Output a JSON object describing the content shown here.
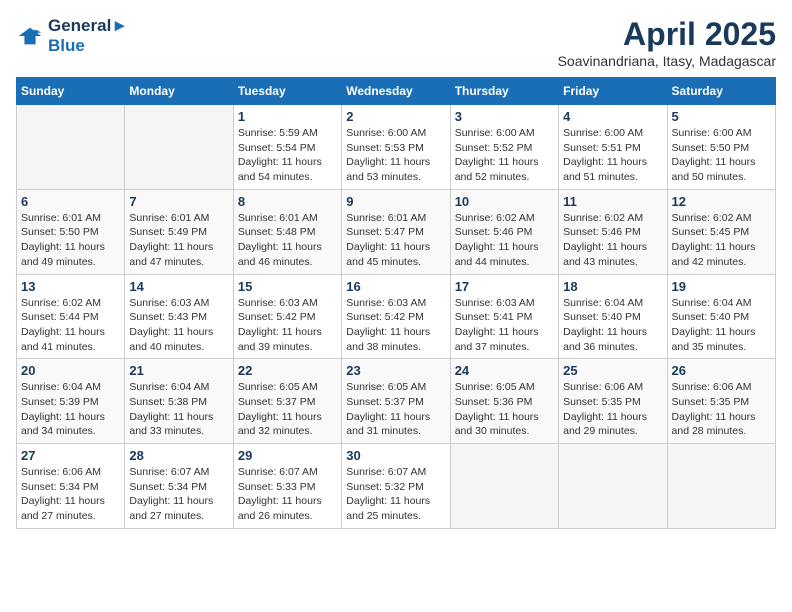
{
  "header": {
    "logo_line1": "General",
    "logo_line2": "Blue",
    "month_title": "April 2025",
    "subtitle": "Soavinandriana, Itasy, Madagascar"
  },
  "days_of_week": [
    "Sunday",
    "Monday",
    "Tuesday",
    "Wednesday",
    "Thursday",
    "Friday",
    "Saturday"
  ],
  "weeks": [
    [
      {
        "day": "",
        "info": ""
      },
      {
        "day": "",
        "info": ""
      },
      {
        "day": "1",
        "info": "Sunrise: 5:59 AM\nSunset: 5:54 PM\nDaylight: 11 hours and 54 minutes."
      },
      {
        "day": "2",
        "info": "Sunrise: 6:00 AM\nSunset: 5:53 PM\nDaylight: 11 hours and 53 minutes."
      },
      {
        "day": "3",
        "info": "Sunrise: 6:00 AM\nSunset: 5:52 PM\nDaylight: 11 hours and 52 minutes."
      },
      {
        "day": "4",
        "info": "Sunrise: 6:00 AM\nSunset: 5:51 PM\nDaylight: 11 hours and 51 minutes."
      },
      {
        "day": "5",
        "info": "Sunrise: 6:00 AM\nSunset: 5:50 PM\nDaylight: 11 hours and 50 minutes."
      }
    ],
    [
      {
        "day": "6",
        "info": "Sunrise: 6:01 AM\nSunset: 5:50 PM\nDaylight: 11 hours and 49 minutes."
      },
      {
        "day": "7",
        "info": "Sunrise: 6:01 AM\nSunset: 5:49 PM\nDaylight: 11 hours and 47 minutes."
      },
      {
        "day": "8",
        "info": "Sunrise: 6:01 AM\nSunset: 5:48 PM\nDaylight: 11 hours and 46 minutes."
      },
      {
        "day": "9",
        "info": "Sunrise: 6:01 AM\nSunset: 5:47 PM\nDaylight: 11 hours and 45 minutes."
      },
      {
        "day": "10",
        "info": "Sunrise: 6:02 AM\nSunset: 5:46 PM\nDaylight: 11 hours and 44 minutes."
      },
      {
        "day": "11",
        "info": "Sunrise: 6:02 AM\nSunset: 5:46 PM\nDaylight: 11 hours and 43 minutes."
      },
      {
        "day": "12",
        "info": "Sunrise: 6:02 AM\nSunset: 5:45 PM\nDaylight: 11 hours and 42 minutes."
      }
    ],
    [
      {
        "day": "13",
        "info": "Sunrise: 6:02 AM\nSunset: 5:44 PM\nDaylight: 11 hours and 41 minutes."
      },
      {
        "day": "14",
        "info": "Sunrise: 6:03 AM\nSunset: 5:43 PM\nDaylight: 11 hours and 40 minutes."
      },
      {
        "day": "15",
        "info": "Sunrise: 6:03 AM\nSunset: 5:42 PM\nDaylight: 11 hours and 39 minutes."
      },
      {
        "day": "16",
        "info": "Sunrise: 6:03 AM\nSunset: 5:42 PM\nDaylight: 11 hours and 38 minutes."
      },
      {
        "day": "17",
        "info": "Sunrise: 6:03 AM\nSunset: 5:41 PM\nDaylight: 11 hours and 37 minutes."
      },
      {
        "day": "18",
        "info": "Sunrise: 6:04 AM\nSunset: 5:40 PM\nDaylight: 11 hours and 36 minutes."
      },
      {
        "day": "19",
        "info": "Sunrise: 6:04 AM\nSunset: 5:40 PM\nDaylight: 11 hours and 35 minutes."
      }
    ],
    [
      {
        "day": "20",
        "info": "Sunrise: 6:04 AM\nSunset: 5:39 PM\nDaylight: 11 hours and 34 minutes."
      },
      {
        "day": "21",
        "info": "Sunrise: 6:04 AM\nSunset: 5:38 PM\nDaylight: 11 hours and 33 minutes."
      },
      {
        "day": "22",
        "info": "Sunrise: 6:05 AM\nSunset: 5:37 PM\nDaylight: 11 hours and 32 minutes."
      },
      {
        "day": "23",
        "info": "Sunrise: 6:05 AM\nSunset: 5:37 PM\nDaylight: 11 hours and 31 minutes."
      },
      {
        "day": "24",
        "info": "Sunrise: 6:05 AM\nSunset: 5:36 PM\nDaylight: 11 hours and 30 minutes."
      },
      {
        "day": "25",
        "info": "Sunrise: 6:06 AM\nSunset: 5:35 PM\nDaylight: 11 hours and 29 minutes."
      },
      {
        "day": "26",
        "info": "Sunrise: 6:06 AM\nSunset: 5:35 PM\nDaylight: 11 hours and 28 minutes."
      }
    ],
    [
      {
        "day": "27",
        "info": "Sunrise: 6:06 AM\nSunset: 5:34 PM\nDaylight: 11 hours and 27 minutes."
      },
      {
        "day": "28",
        "info": "Sunrise: 6:07 AM\nSunset: 5:34 PM\nDaylight: 11 hours and 27 minutes."
      },
      {
        "day": "29",
        "info": "Sunrise: 6:07 AM\nSunset: 5:33 PM\nDaylight: 11 hours and 26 minutes."
      },
      {
        "day": "30",
        "info": "Sunrise: 6:07 AM\nSunset: 5:32 PM\nDaylight: 11 hours and 25 minutes."
      },
      {
        "day": "",
        "info": ""
      },
      {
        "day": "",
        "info": ""
      },
      {
        "day": "",
        "info": ""
      }
    ]
  ]
}
